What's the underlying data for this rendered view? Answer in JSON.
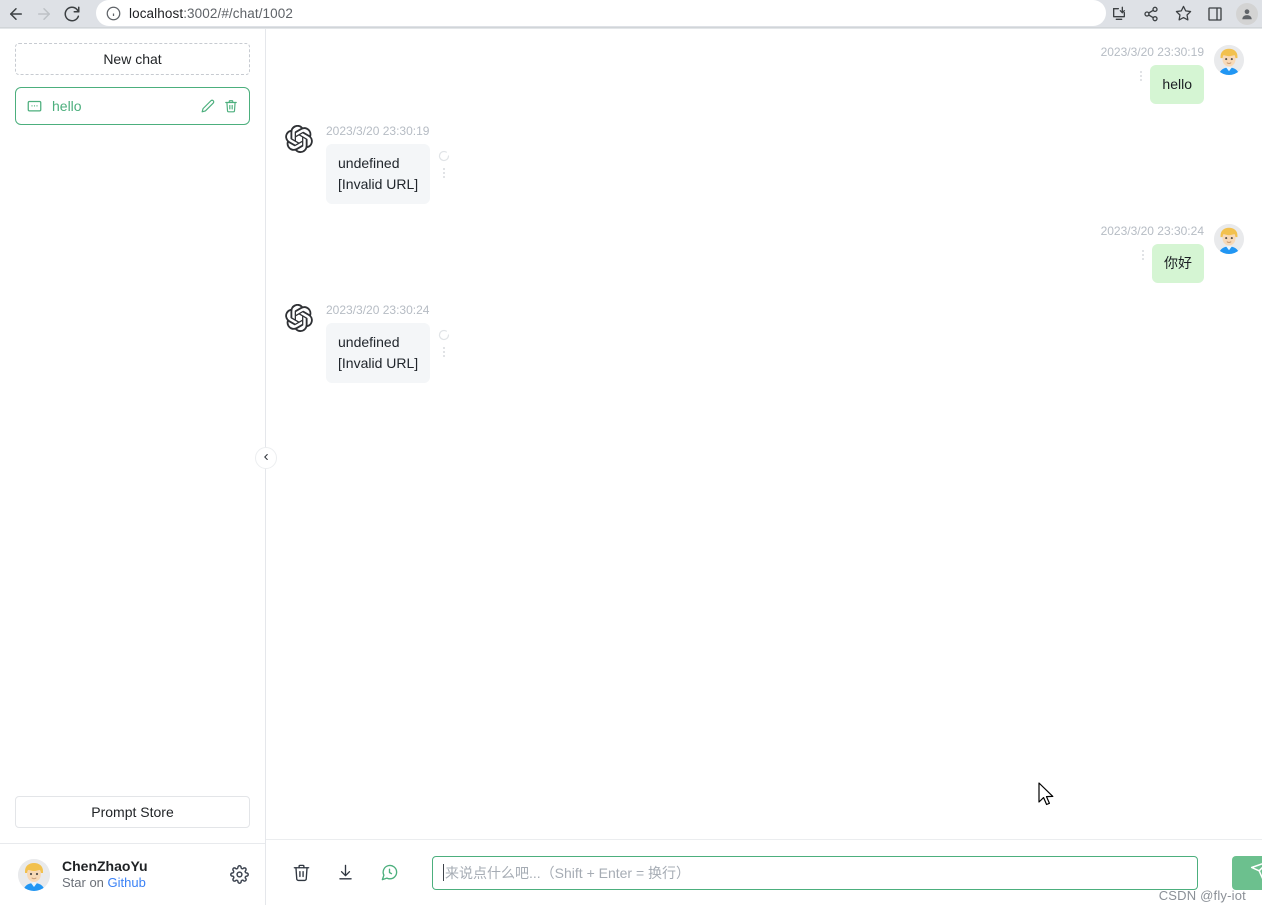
{
  "browser": {
    "url_prefix": "localhost",
    "url_suffix": ":3002/#/chat/1002",
    "back_icon": "back-arrow-icon",
    "forward_icon": "forward-arrow-icon",
    "reload_icon": "reload-icon",
    "info_icon": "site-info-icon",
    "install_icon": "install-app-icon",
    "share_icon": "share-icon",
    "bookmark_icon": "star-bookmark-icon",
    "sidepanel_icon": "side-panel-icon",
    "profile_icon": "profile-avatar-icon"
  },
  "sidebar": {
    "new_chat_label": "New chat",
    "chats": [
      {
        "title": "hello",
        "icon": "message-square-icon",
        "edit_icon": "pencil-edit-icon",
        "delete_icon": "trash-delete-icon",
        "active": true
      }
    ],
    "prompt_store_label": "Prompt Store",
    "user": {
      "name": "ChenZhaoYu",
      "sub_prefix": "Star on ",
      "sub_link": "Github",
      "settings_icon": "gear-settings-icon",
      "avatar_icon": "user-avatar-icon"
    },
    "collapse_icon": "chevron-left-icon"
  },
  "conversation": {
    "messages": [
      {
        "role": "user",
        "time": "2023/3/20 23:30:19",
        "text": "hello",
        "avatar_icon": "user-avatar-icon",
        "menu_icon": "more-options-icon"
      },
      {
        "role": "assistant",
        "time": "2023/3/20 23:30:19",
        "text": "undefined\n[Invalid URL]",
        "avatar_icon": "openai-logo-icon",
        "regenerate_icon": "loading-spinner-icon",
        "menu_icon": "more-options-icon"
      },
      {
        "role": "user",
        "time": "2023/3/20 23:30:24",
        "text": "你好",
        "avatar_icon": "user-avatar-icon",
        "menu_icon": "more-options-icon"
      },
      {
        "role": "assistant",
        "time": "2023/3/20 23:30:24",
        "text": "undefined\n[Invalid URL]",
        "avatar_icon": "openai-logo-icon",
        "regenerate_icon": "loading-spinner-icon",
        "menu_icon": "more-options-icon"
      }
    ]
  },
  "composer": {
    "clear_icon": "trash-clear-conversation-icon",
    "export_icon": "download-export-icon",
    "history_icon": "chat-history-icon",
    "placeholder": "来说点什么吧...（Shift + Enter = 换行）",
    "input_value": "",
    "send_icon": "send-paper-plane-icon"
  },
  "watermark": "CSDN @fly-iot",
  "colors": {
    "accent_green": "#4caf7d",
    "user_bubble": "#d5f5d3",
    "assistant_bubble": "#f4f6f8",
    "link_blue": "#3b82f6",
    "send_button": "#6cc08e"
  }
}
